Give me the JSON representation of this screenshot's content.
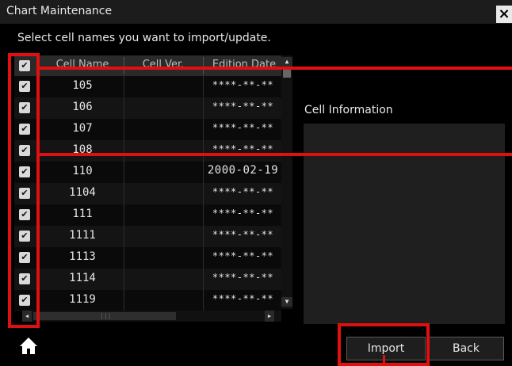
{
  "window": {
    "title": "Chart Maintenance",
    "close_icon": "×"
  },
  "instruction": "Select cell names you want to import/update.",
  "table": {
    "columns": [
      "Cell Name",
      "Cell Ver.",
      "Edition Date"
    ],
    "header_checkbox": "✔",
    "rows": [
      {
        "checked": "✔",
        "name": "105",
        "ver": "",
        "date": "****-**-**"
      },
      {
        "checked": "✔",
        "name": "106",
        "ver": "",
        "date": "****-**-**"
      },
      {
        "checked": "✔",
        "name": "107",
        "ver": "",
        "date": "****-**-**"
      },
      {
        "checked": "✔",
        "name": "108",
        "ver": "",
        "date": "****-**-**"
      },
      {
        "checked": "✔",
        "name": "110",
        "ver": "",
        "date": "2000-02-19"
      },
      {
        "checked": "✔",
        "name": "1104",
        "ver": "",
        "date": "****-**-**"
      },
      {
        "checked": "✔",
        "name": "111",
        "ver": "",
        "date": "****-**-**"
      },
      {
        "checked": "✔",
        "name": "1111",
        "ver": "",
        "date": "****-**-**"
      },
      {
        "checked": "✔",
        "name": "1113",
        "ver": "",
        "date": "****-**-**"
      },
      {
        "checked": "✔",
        "name": "1114",
        "ver": "",
        "date": "****-**-**"
      },
      {
        "checked": "✔",
        "name": "1119",
        "ver": "",
        "date": "****-**-**"
      }
    ]
  },
  "scroll": {
    "up": "▲",
    "down": "▼",
    "left": "◀",
    "right": "▶",
    "grip": "|||"
  },
  "info": {
    "label": "Cell Information"
  },
  "buttons": {
    "import": "Import",
    "back": "Back"
  },
  "icons": {
    "home": "home-icon",
    "close": "close-icon"
  },
  "colors": {
    "highlight": "#e01010",
    "background": "#000000",
    "panel": "#1f1f1f"
  }
}
